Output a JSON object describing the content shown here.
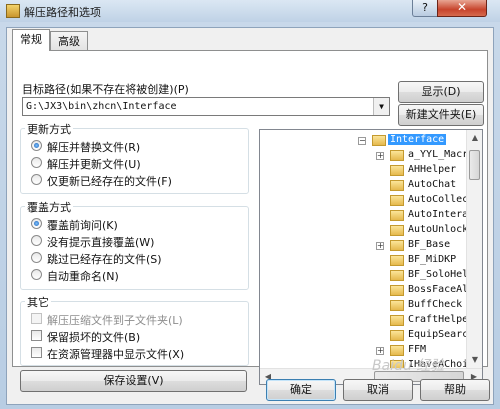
{
  "window": {
    "title": "解压路径和选项",
    "help_symbol": "?",
    "close_symbol": "✕"
  },
  "tabs": [
    {
      "label": "常规",
      "active": true
    },
    {
      "label": "高级",
      "active": false
    }
  ],
  "target_path": {
    "label": "目标路径(如果不存在将被创建)(P)",
    "value": "G:\\JX3\\bin\\zhcn\\Interface"
  },
  "buttons": {
    "show": "显示(D)",
    "new_folder": "新建文件夹(E)",
    "save_settings": "保存设置(V)",
    "ok": "确定",
    "cancel": "取消",
    "help": "帮助"
  },
  "update_mode": {
    "title": "更新方式",
    "options": [
      {
        "label": "解压并替换文件(R)",
        "selected": true
      },
      {
        "label": "解压并更新文件(U)",
        "selected": false
      },
      {
        "label": "仅更新已经存在的文件(F)",
        "selected": false
      }
    ]
  },
  "overwrite_mode": {
    "title": "覆盖方式",
    "options": [
      {
        "label": "覆盖前询问(K)",
        "selected": true
      },
      {
        "label": "没有提示直接覆盖(W)",
        "selected": false
      },
      {
        "label": "跳过已经存在的文件(S)",
        "selected": false
      },
      {
        "label": "自动重命名(N)",
        "selected": false
      }
    ]
  },
  "misc": {
    "title": "其它",
    "options": [
      {
        "label": "解压压缩文件到子文件夹(L)",
        "checked": false,
        "disabled": true
      },
      {
        "label": "保留损坏的文件(B)",
        "checked": false,
        "disabled": false
      },
      {
        "label": "在资源管理器中显示文件(X)",
        "checked": false,
        "disabled": false
      }
    ]
  },
  "tree": {
    "root": "Interface",
    "items": [
      {
        "name": "a_YYL_Macro",
        "expandable": true
      },
      {
        "name": "AHHelper",
        "expandable": false
      },
      {
        "name": "AutoChat",
        "expandable": false
      },
      {
        "name": "AutoCollect",
        "expandable": false
      },
      {
        "name": "AutoInteract",
        "expandable": false
      },
      {
        "name": "AutoUnlock",
        "expandable": false
      },
      {
        "name": "BF_Base",
        "expandable": true
      },
      {
        "name": "BF_MiDKP",
        "expandable": false
      },
      {
        "name": "BF_SoloHelper",
        "expandable": false
      },
      {
        "name": "BossFaceAlert",
        "expandable": false
      },
      {
        "name": "BuffCheck",
        "expandable": false
      },
      {
        "name": "CraftHelper_",
        "expandable": false
      },
      {
        "name": "EquipSearch",
        "expandable": false
      },
      {
        "name": "FFM",
        "expandable": true
      },
      {
        "name": "IHaveAChoice",
        "expandable": false
      }
    ]
  },
  "watermark": "Baidu 经验"
}
